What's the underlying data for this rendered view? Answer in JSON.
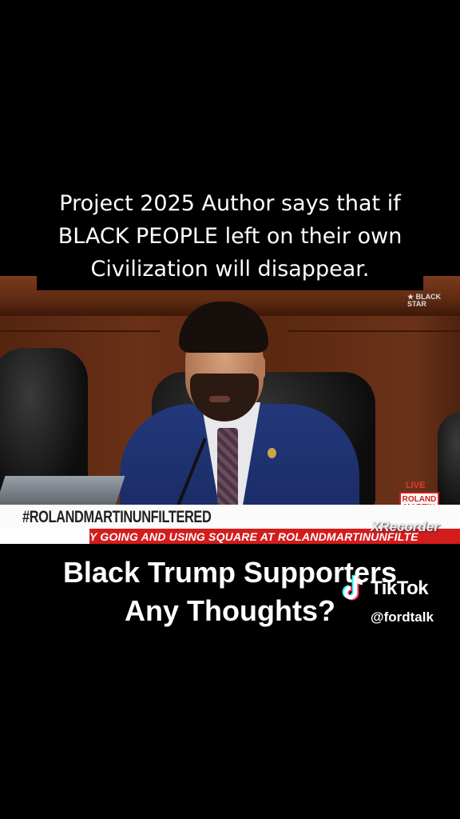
{
  "top_caption": {
    "line1": "Project 2025 Author says that if",
    "line2": "BLACK PEOPLE left on their own",
    "line3": "Civilization will disappear."
  },
  "video": {
    "corner_logo": "BLACK STAR",
    "live_label": "LIVE",
    "show_logo": "ROLAND MARTIN",
    "lower_third": "#ROLANDMARTINUNFILTERED",
    "ticker": "Y GOING AND USING SQUARE AT ROLANDMARTINUNFILTE",
    "recorder_watermark": "XRecorder"
  },
  "bottom_caption": {
    "line1": "Black Trump Supporters",
    "line2": "Any Thoughts?"
  },
  "watermark": {
    "brand": "TikTok",
    "handle": "@fordtalk",
    "icon": "tiktok-icon"
  },
  "colors": {
    "background": "#000000",
    "ticker_red": "#d31c1c",
    "suit_blue": "#23387a"
  }
}
